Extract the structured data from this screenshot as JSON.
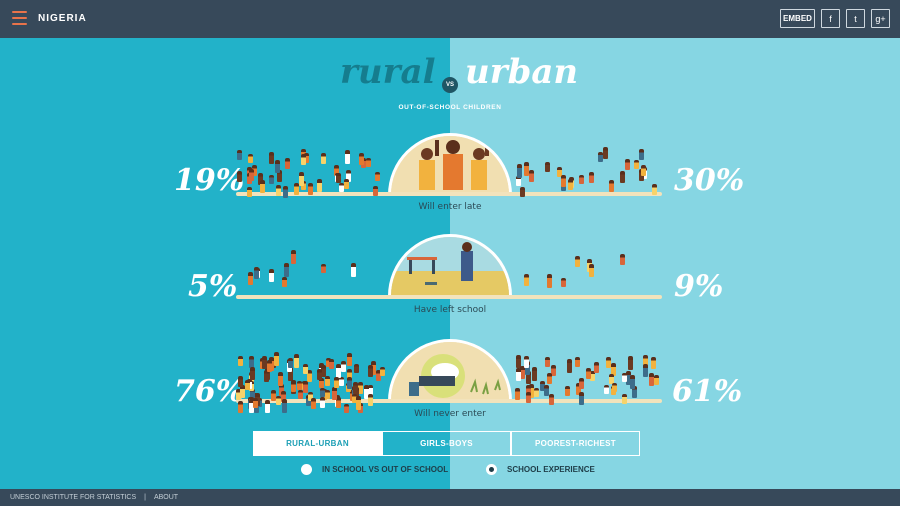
{
  "header": {
    "country": "NIGERIA",
    "embed_label": "EMBED",
    "share": [
      {
        "label": "f",
        "icon": "facebook-icon"
      },
      {
        "label": "t",
        "icon": "twitter-icon"
      },
      {
        "label": "g+",
        "icon": "google-plus-icon"
      }
    ]
  },
  "title": {
    "left": "rural",
    "vs": "VS",
    "right": "urban"
  },
  "subtitle": "OUT-OF-SCHOOL CHILDREN",
  "rows": [
    {
      "caption": "Will enter late",
      "left_pct": "19%",
      "right_pct": "30%"
    },
    {
      "caption": "Have left school",
      "left_pct": "5%",
      "right_pct": "9%"
    },
    {
      "caption": "Will never enter",
      "left_pct": "76%",
      "right_pct": "61%"
    }
  ],
  "tabs": [
    {
      "label": "RURAL-URBAN",
      "active": true
    },
    {
      "label": "GIRLS-BOYS",
      "active": false
    },
    {
      "label": "POOREST-RICHEST",
      "active": false
    }
  ],
  "options": [
    {
      "label": "IN SCHOOL VS OUT OF SCHOOL",
      "selected": false
    },
    {
      "label": "SCHOOL EXPERIENCE",
      "selected": true
    }
  ],
  "footer": {
    "org": "UNESCO INSTITUTE FOR STATISTICS",
    "about": "ABOUT"
  },
  "colors": {
    "left_bg": "#22b2c9",
    "right_bg": "#86d6e3",
    "accent": "#e8734a",
    "header_bg": "#37495a"
  }
}
